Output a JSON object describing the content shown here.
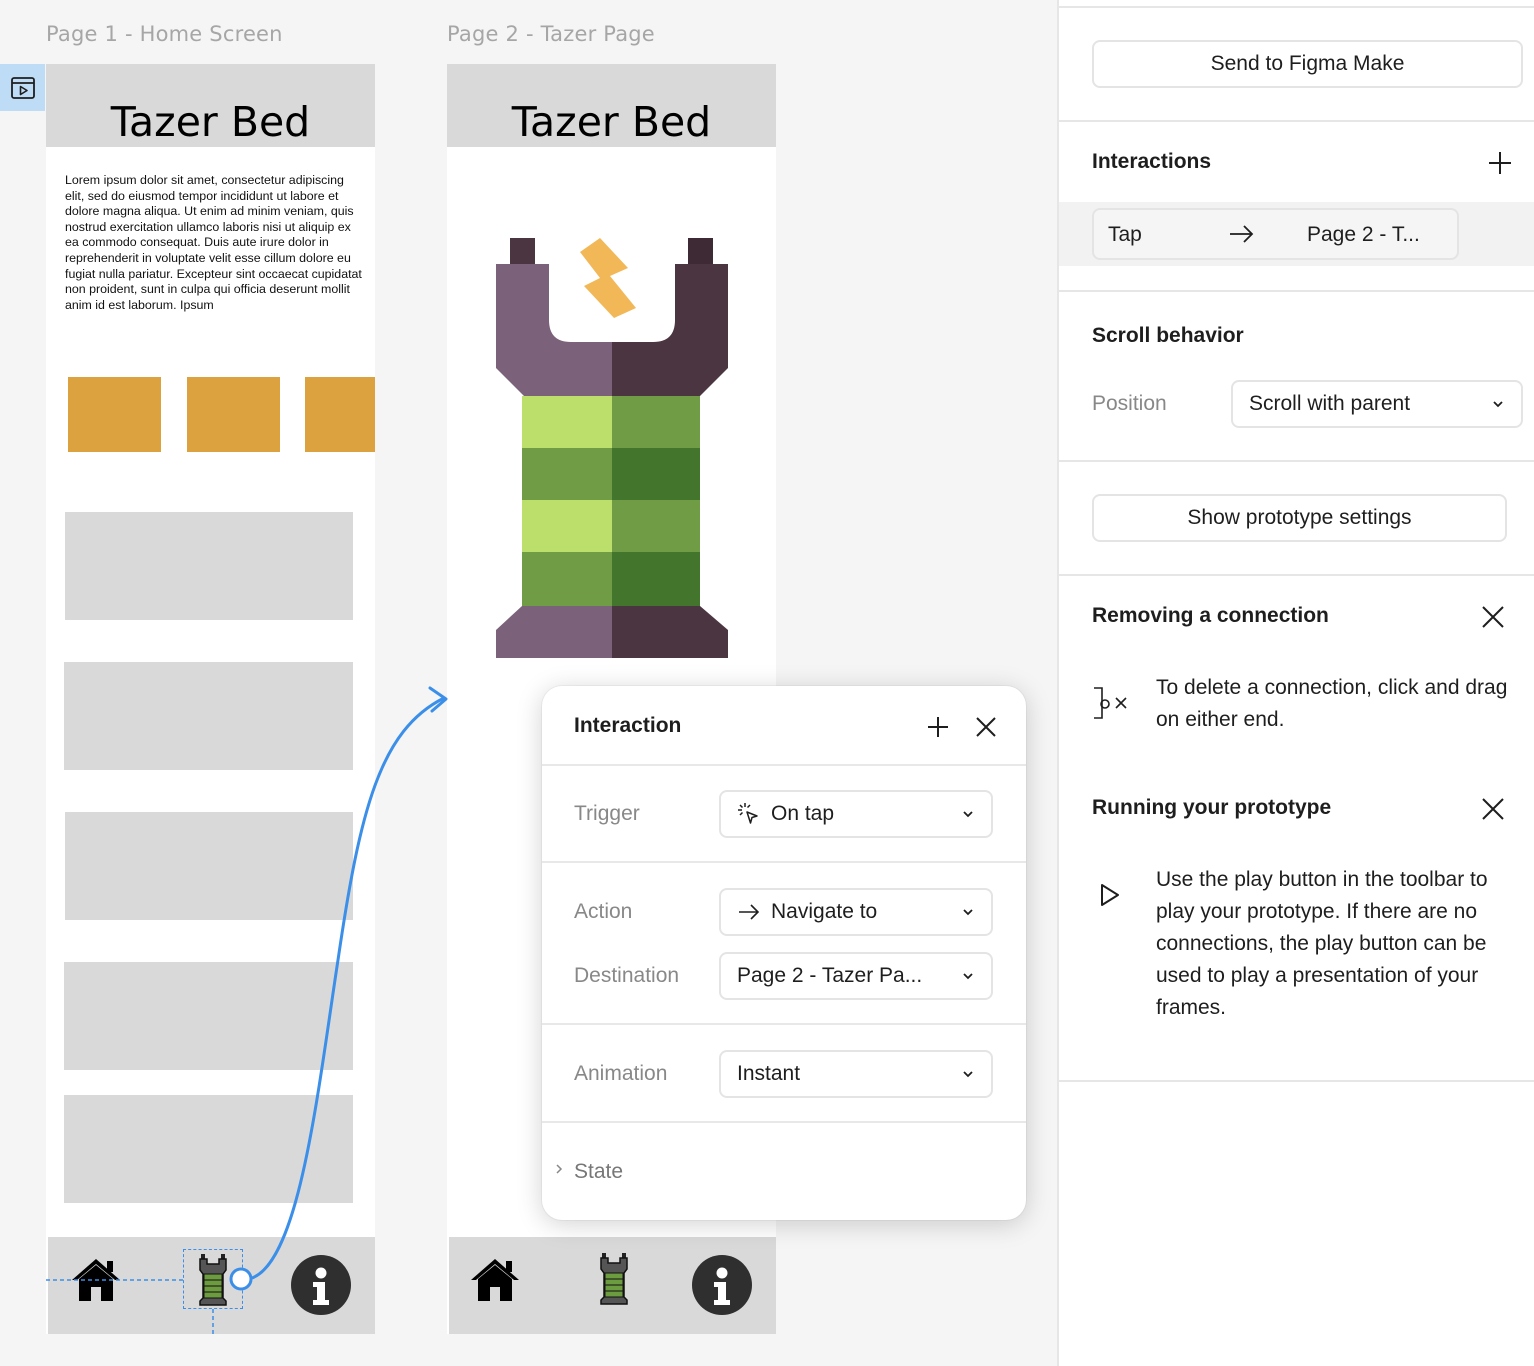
{
  "canvas": {
    "frame1": {
      "label": "Page 1 - Home Screen",
      "title": "Tazer Bed",
      "body_text": "Lorem ipsum dolor sit amet, consectetur adipiscing elit, sed do eiusmod tempor incididunt ut labore et dolore magna aliqua. Ut enim ad minim veniam, quis nostrud exercitation ullamco laboris nisi ut aliquip ex ea commodo consequat. Duis aute irure dolor in reprehenderit in voluptate velit esse cillum dolore eu fugiat nulla pariatur. Excepteur sint occaecat cupidatat non proident, sunt in culpa qui officia deserunt mollit anim id est laborum. Ipsum"
    },
    "frame2": {
      "label": "Page 2 - Tazer Page",
      "title": "Tazer Bed"
    },
    "nav_icons": [
      "home-icon",
      "taser-icon",
      "info-icon"
    ],
    "colors": {
      "connector": "#3b8fe8",
      "orange_block": "#dba23f",
      "placeholder_gray": "#d9d9d9",
      "selection_blue": "#bfdcf7"
    }
  },
  "popover": {
    "title": "Interaction",
    "trigger": {
      "label": "Trigger",
      "value": "On tap"
    },
    "action": {
      "label": "Action",
      "value": "Navigate to"
    },
    "destination": {
      "label": "Destination",
      "value": "Page 2 - Tazer Pa..."
    },
    "animation": {
      "label": "Animation",
      "value": "Instant"
    },
    "state": {
      "label": "State"
    }
  },
  "panel": {
    "send_button": "Send to Figma Make",
    "interactions": {
      "heading": "Interactions",
      "row": {
        "trigger": "Tap",
        "destination": "Page 2 - T..."
      }
    },
    "scroll": {
      "heading": "Scroll behavior",
      "position_label": "Position",
      "position_value": "Scroll with parent"
    },
    "prototype_settings_button": "Show prototype settings",
    "tip_remove": {
      "heading": "Removing a connection",
      "text": "To delete a connection, click and drag on either end."
    },
    "tip_run": {
      "heading": "Running your prototype",
      "text": "Use the play button in the toolbar to play your prototype. If there are no connections, the play button can be used to play a presentation of your frames."
    }
  }
}
